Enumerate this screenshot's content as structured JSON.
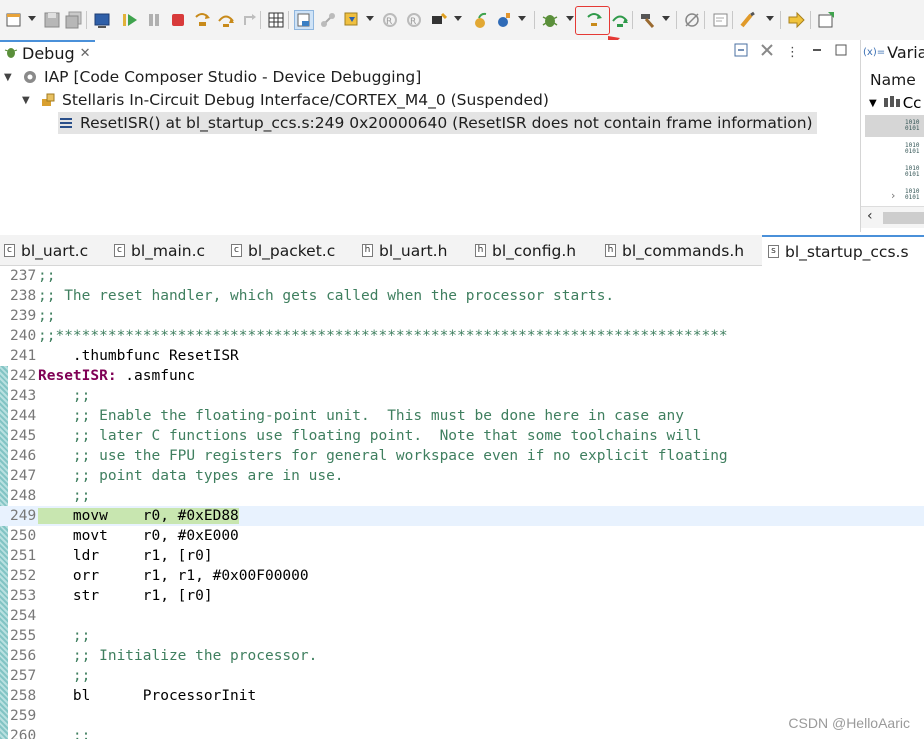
{
  "debug_view": {
    "tab_title": "Debug",
    "tree": [
      {
        "label": "IAP [Code Composer Studio - Device Debugging]",
        "level": 0
      },
      {
        "label": "Stellaris In-Circuit Debug Interface/CORTEX_M4_0 (Suspended)",
        "level": 1
      },
      {
        "label": "ResetISR() at bl_startup_ccs.s:249 0x20000640  (ResetISR does not contain frame information)",
        "level": 2,
        "selected": true
      }
    ]
  },
  "variables_view": {
    "tab_title": "Varial",
    "x_badge": "(x)=",
    "column_header": "Name",
    "first_row": "Cc"
  },
  "editor": {
    "tabs": [
      {
        "label": "bl_uart.c",
        "type": "c"
      },
      {
        "label": "bl_main.c",
        "type": "c"
      },
      {
        "label": "bl_packet.c",
        "type": "c"
      },
      {
        "label": "bl_uart.h",
        "type": "h"
      },
      {
        "label": "bl_config.h",
        "type": "h"
      },
      {
        "label": "bl_commands.h",
        "type": "h"
      },
      {
        "label": "bl_startup_ccs.s",
        "type": "s",
        "active": true
      }
    ],
    "current_line": "249",
    "lines": [
      {
        "n": "237",
        "kind": "comment",
        "text": ";;"
      },
      {
        "n": "238",
        "kind": "comment",
        "text": ";; The reset handler, which gets called when the processor starts."
      },
      {
        "n": "239",
        "kind": "comment",
        "text": ";;"
      },
      {
        "n": "240",
        "kind": "comment",
        "text": ";;*****************************************************************************"
      },
      {
        "n": "241",
        "kind": "code",
        "text": "    .thumbfunc ResetISR"
      },
      {
        "n": "242",
        "kind": "label",
        "label": "ResetISR:",
        "text": " .asmfunc"
      },
      {
        "n": "243",
        "kind": "comment",
        "text": "    ;;"
      },
      {
        "n": "244",
        "kind": "comment",
        "text": "    ;; Enable the floating-point unit.  This must be done here in case any"
      },
      {
        "n": "245",
        "kind": "comment",
        "text": "    ;; later C functions use floating point.  Note that some toolchains will"
      },
      {
        "n": "246",
        "kind": "comment",
        "text": "    ;; use the FPU registers for general workspace even if no explicit floating"
      },
      {
        "n": "247",
        "kind": "comment",
        "text": "    ;; point data types are in use."
      },
      {
        "n": "248",
        "kind": "comment",
        "text": "    ;;"
      },
      {
        "n": "249",
        "kind": "current",
        "text": "    movw    r0, #0xED88"
      },
      {
        "n": "250",
        "kind": "code",
        "text": "    movt    r0, #0xE000"
      },
      {
        "n": "251",
        "kind": "code",
        "text": "    ldr     r1, [r0]"
      },
      {
        "n": "252",
        "kind": "code",
        "text": "    orr     r1, r1, #0x00F00000"
      },
      {
        "n": "253",
        "kind": "code",
        "text": "    str     r1, [r0]"
      },
      {
        "n": "254",
        "kind": "code",
        "text": ""
      },
      {
        "n": "255",
        "kind": "comment",
        "text": "    ;;"
      },
      {
        "n": "256",
        "kind": "comment",
        "text": "    ;; Initialize the processor."
      },
      {
        "n": "257",
        "kind": "comment",
        "text": "    ;;"
      },
      {
        "n": "258",
        "kind": "code",
        "text": "    bl      ProcessorInit"
      },
      {
        "n": "259",
        "kind": "code",
        "text": ""
      },
      {
        "n": "260",
        "kind": "comment",
        "text": "    ;;"
      }
    ]
  },
  "watermark": "CSDN @HelloAaric",
  "colors": {
    "comment": "#3f7f5f",
    "label": "#7f0055",
    "highlight": "#e53935",
    "current_line_bg": "#e8f2fe",
    "current_line_mark": "#c8e6b0"
  }
}
